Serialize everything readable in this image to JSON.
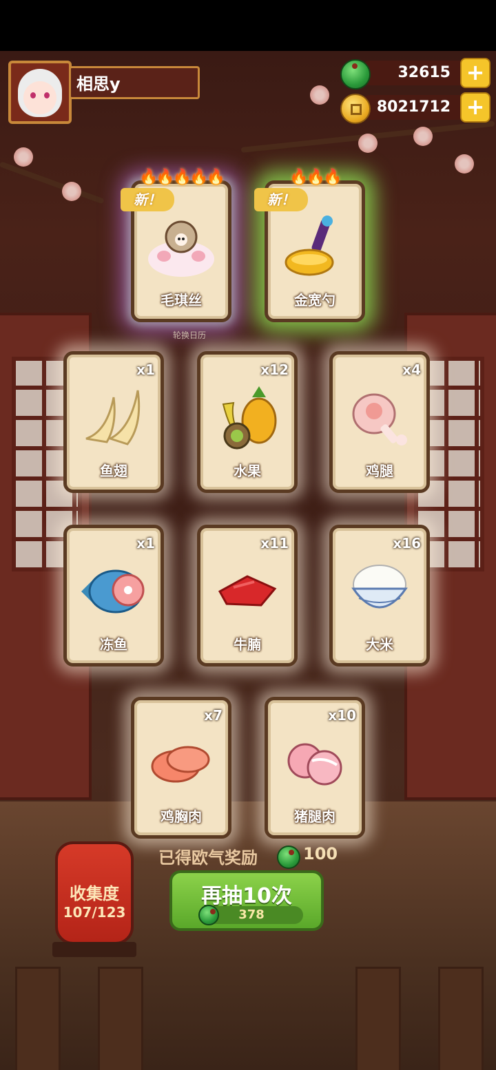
{
  "player": {
    "name": "相思y"
  },
  "currency": {
    "jade": "32615",
    "coins": "8021712",
    "plus": "+"
  },
  "featured": [
    {
      "name": "毛琪丝",
      "tag": "新！",
      "stars": 5
    },
    {
      "name": "金宽勺",
      "tag": "新！",
      "stars": 3
    }
  ],
  "caption": "轮换日历",
  "cards": [
    {
      "name": "鱼翅",
      "qty": "x1"
    },
    {
      "name": "水果",
      "qty": "x12"
    },
    {
      "name": "鸡腿",
      "qty": "x4"
    },
    {
      "name": "冻鱼",
      "qty": "x1"
    },
    {
      "name": "牛腩",
      "qty": "x11"
    },
    {
      "name": "大米",
      "qty": "x16"
    },
    {
      "name": "鸡胸肉",
      "qty": "x7"
    },
    {
      "name": "猪腿肉",
      "qty": "x10"
    }
  ],
  "reward": {
    "label": "已得欧气奖励",
    "value": "100"
  },
  "collection": {
    "label": "收集度",
    "count": "107/123"
  },
  "draw": {
    "label": "再抽10次",
    "cost": "378"
  },
  "icons": {
    "flame": "🔥",
    "jade": "jade-icon",
    "coin": "coin-icon"
  }
}
